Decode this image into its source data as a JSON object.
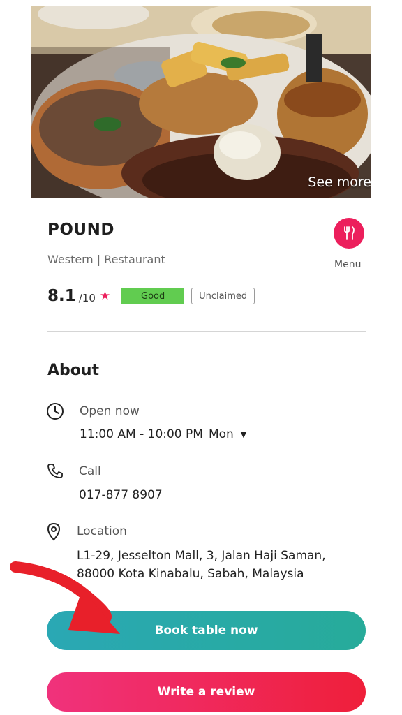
{
  "hero": {
    "see_more": "See more"
  },
  "restaurant": {
    "name": "POUND",
    "cuisine": "Western | Restaurant",
    "rating": "8.1",
    "rating_out_of": "/10",
    "rating_badge": "Good",
    "claim_status": "Unclaimed"
  },
  "menu": {
    "label": "Menu",
    "icon": "fork-knife-icon"
  },
  "about": {
    "title": "About",
    "hours": {
      "label": "Open now",
      "time": "11:00 AM - 10:00 PM",
      "day": "Mon"
    },
    "call": {
      "label": "Call",
      "phone": "017-877 8907"
    },
    "location": {
      "label": "Location",
      "address_line1": "L1-29, Jesselton Mall, 3, Jalan Haji Saman,",
      "address_line2": "88000 Kota Kinabalu, Sabah, Malaysia"
    }
  },
  "actions": {
    "book": "Book table now",
    "review": "Write a review"
  },
  "colors": {
    "accent_pink": "#ec1f5c",
    "good_green": "#61cc50",
    "book_teal": "#2aa8b4",
    "review_red": "#ef1f3a",
    "annotation_arrow": "#e8202a"
  }
}
